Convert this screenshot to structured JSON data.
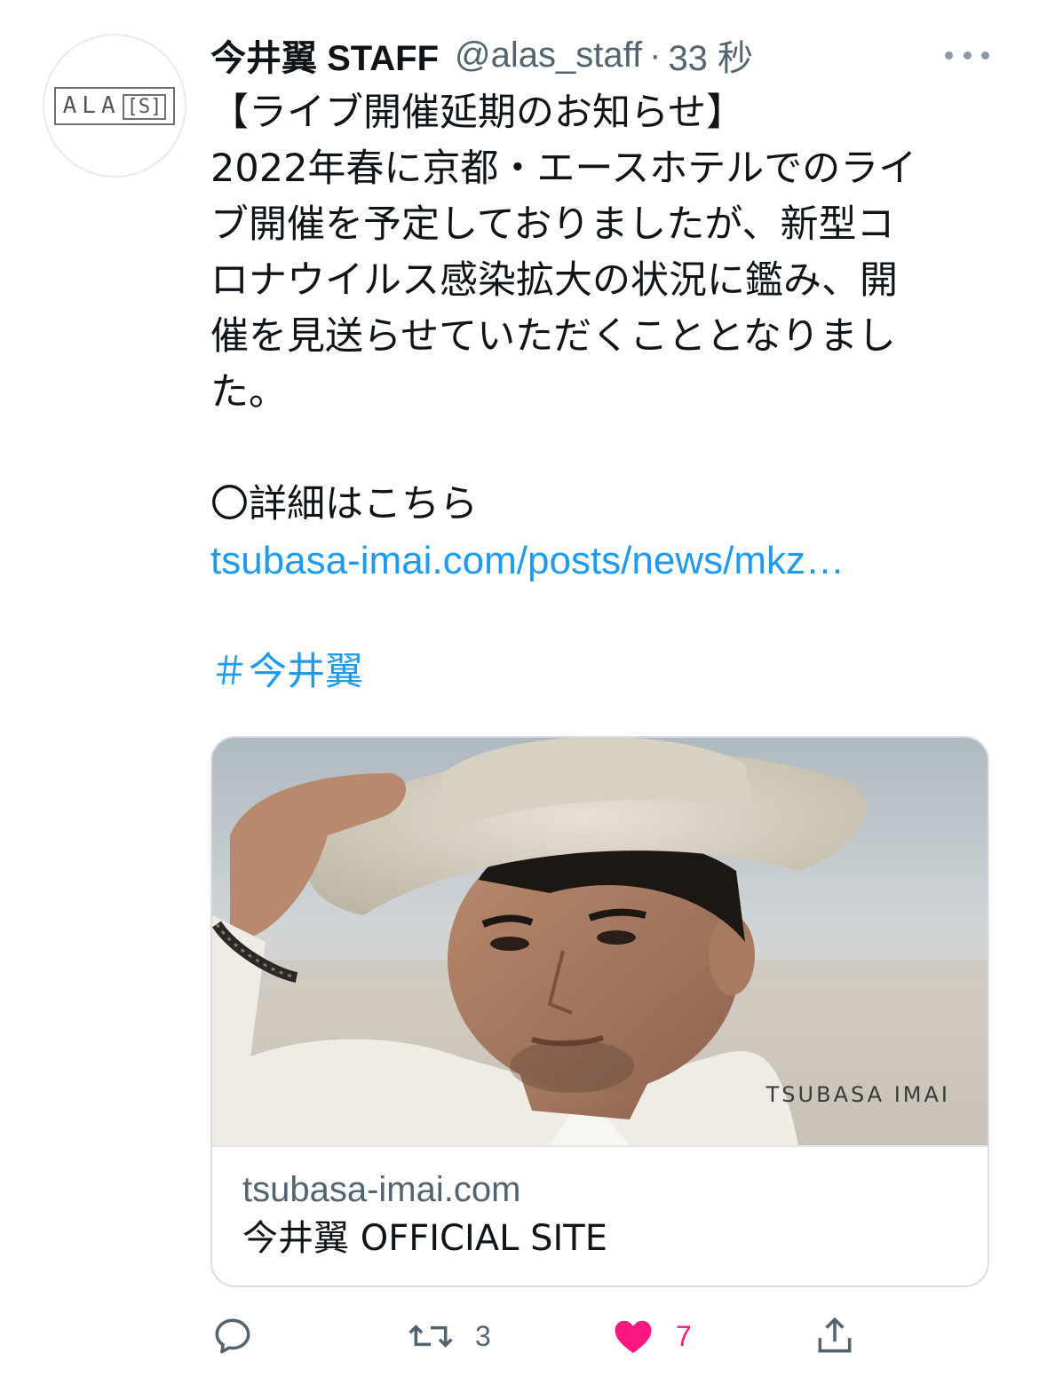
{
  "tweet": {
    "author_name": "今井翼 STAFF",
    "author_handle": "@alas_staff",
    "separator": "·",
    "timestamp": "33 秒",
    "avatar_logo_text": "ALA",
    "avatar_logo_bracket": "[S]",
    "body_lines": [
      "【ライブ開催延期のお知らせ】",
      "2022年春に京都・エースホテルでのライ",
      "ブ開催を予定しておりましたが、新型コ",
      "ロナウイルス感染拡大の状況に鑑み、開",
      "催を見送らせていただくこととなりまし",
      "た。"
    ],
    "details_label": "〇詳細はこちら",
    "link_text": "tsubasa-imai.com/posts/news/mkz…",
    "hashtag": "＃今井翼"
  },
  "card": {
    "photo_label": "TSUBASA IMAI",
    "domain": "tsubasa-imai.com",
    "title": "今井翼 OFFICIAL SITE"
  },
  "actions": {
    "reply_count": "",
    "retweet_count": "3",
    "like_count": "7",
    "like_color": "#f91880",
    "icons": [
      "reply-icon",
      "retweet-icon",
      "like-icon",
      "share-icon"
    ]
  },
  "colors": {
    "link": "#1d9bf0",
    "secondary_text": "#536471",
    "primary_text": "#0f1419",
    "border": "#d9dde1"
  }
}
